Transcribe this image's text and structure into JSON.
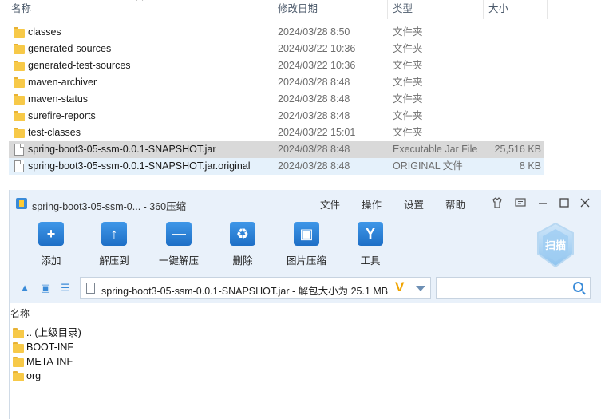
{
  "explorer": {
    "columns": {
      "name": "名称",
      "date": "修改日期",
      "type": "类型",
      "size": "大小"
    },
    "rows": [
      {
        "name": "classes",
        "date": "2024/03/28 8:50",
        "type": "文件夹",
        "size": "",
        "kind": "folder-icon"
      },
      {
        "name": "generated-sources",
        "date": "2024/03/22 10:36",
        "type": "文件夹",
        "size": "",
        "kind": "folder-icon"
      },
      {
        "name": "generated-test-sources",
        "date": "2024/03/22 10:36",
        "type": "文件夹",
        "size": "",
        "kind": "folder-icon"
      },
      {
        "name": "maven-archiver",
        "date": "2024/03/28 8:48",
        "type": "文件夹",
        "size": "",
        "kind": "folder-icon"
      },
      {
        "name": "maven-status",
        "date": "2024/03/28 8:48",
        "type": "文件夹",
        "size": "",
        "kind": "folder-icon"
      },
      {
        "name": "surefire-reports",
        "date": "2024/03/28 8:48",
        "type": "文件夹",
        "size": "",
        "kind": "folder-icon"
      },
      {
        "name": "test-classes",
        "date": "2024/03/22 15:01",
        "type": "文件夹",
        "size": "",
        "kind": "folder-icon"
      },
      {
        "name": "spring-boot3-05-ssm-0.0.1-SNAPSHOT.jar",
        "date": "2024/03/28 8:48",
        "type": "Executable Jar File",
        "size": "25,516 KB",
        "kind": "file-icon"
      },
      {
        "name": "spring-boot3-05-ssm-0.0.1-SNAPSHOT.jar.original",
        "date": "2024/03/28 8:48",
        "type": "ORIGINAL 文件",
        "size": "8 KB",
        "kind": "file-icon"
      }
    ]
  },
  "zipwin": {
    "title": "spring-boot3-05-ssm-0... - 360压缩",
    "menu": {
      "file": "文件",
      "ops": "操作",
      "settings": "设置",
      "help": "帮助"
    },
    "tools": {
      "add": "添加",
      "extract_to": "解压到",
      "one_click": "一键解压",
      "delete": "删除",
      "image_compress": "图片压缩",
      "tools": "工具"
    },
    "scan_label": "扫描",
    "path_text": "spring-boot3-05-ssm-0.0.1-SNAPSHOT.jar - 解包大小为 25.1 MB",
    "search_placeholder": "",
    "list_header": "名称",
    "items": [
      {
        "name": ".. (上级目录)"
      },
      {
        "name": "BOOT-INF"
      },
      {
        "name": "META-INF"
      },
      {
        "name": "org"
      }
    ],
    "colors": {
      "accent": "#3a8bd8",
      "chrome": "#e9f1fa",
      "folder": "#f7c948"
    }
  }
}
